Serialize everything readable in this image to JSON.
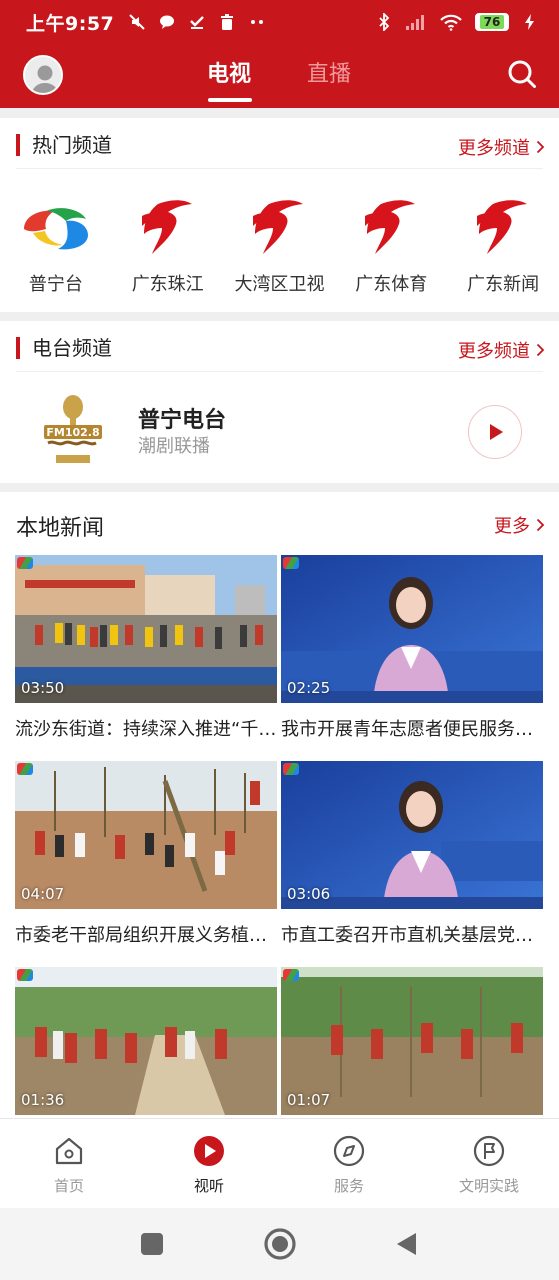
{
  "status_bar": {
    "time": "上午9:57",
    "battery": "76"
  },
  "header": {
    "tabs": [
      "电视",
      "直播"
    ],
    "active_tab": "电视"
  },
  "hot_channels": {
    "title": "热门频道",
    "more": "更多频道",
    "items": [
      {
        "name": "普宁台",
        "icon": "puning-tv-logo-icon"
      },
      {
        "name": "广东珠江",
        "icon": "gdtv-logo-icon"
      },
      {
        "name": "大湾区卫视",
        "icon": "gdtv-logo-icon"
      },
      {
        "name": "广东体育",
        "icon": "gdtv-logo-icon"
      },
      {
        "name": "广东新闻",
        "icon": "gdtv-logo-icon"
      }
    ]
  },
  "radio_channels": {
    "title": "电台频道",
    "more": "更多频道",
    "station": {
      "name": "普宁电台",
      "subtitle": "潮剧联播",
      "logo_text": "FM102.8"
    }
  },
  "local_news": {
    "title": "本地新闻",
    "more": "更多",
    "items": [
      {
        "duration": "03:50",
        "title": "流沙东街道：持续深入推进“千村万池百里河道”清淤行动"
      },
      {
        "duration": "02:25",
        "title": "我市开展青年志愿者便民服务活动"
      },
      {
        "duration": "04:07",
        "title": "市委老干部局组织开展义务植树活动"
      },
      {
        "duration": "03:06",
        "title": "市直工委召开市直机关基层党建工作会议"
      },
      {
        "duration": "01:36",
        "title": ""
      },
      {
        "duration": "01:07",
        "title": ""
      }
    ]
  },
  "bottom_nav": {
    "items": [
      {
        "label": "首页",
        "icon": "home-icon"
      },
      {
        "label": "视听",
        "icon": "play-icon"
      },
      {
        "label": "服务",
        "icon": "compass-icon"
      },
      {
        "label": "文明实践",
        "icon": "flag-icon"
      }
    ],
    "active": "视听"
  },
  "colors": {
    "brand": "#c8161d",
    "inactive": "#999999"
  }
}
